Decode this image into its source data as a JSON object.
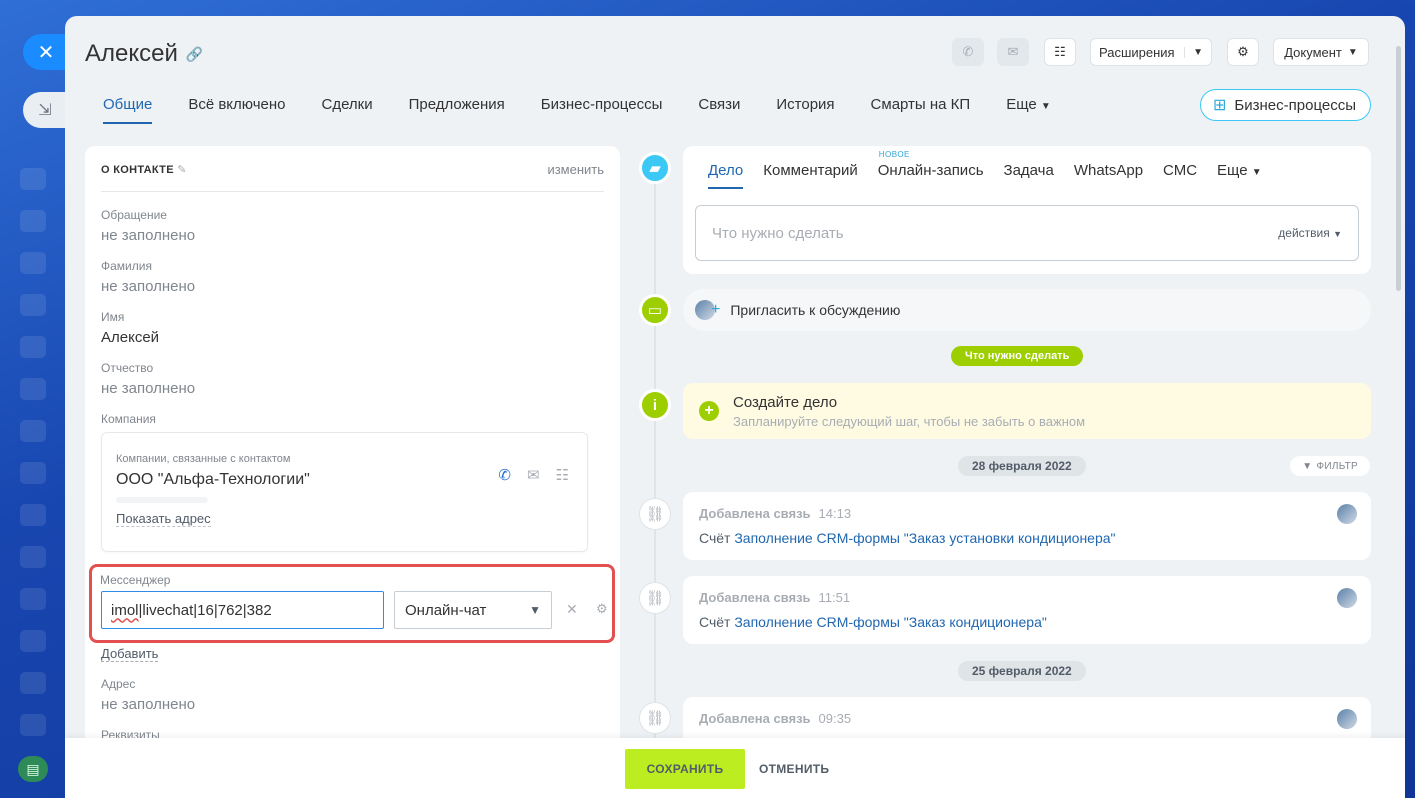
{
  "window": {
    "title": "Алексей"
  },
  "toolbar": {
    "extensions_label": "Расширения",
    "document_label": "Документ"
  },
  "tabs": [
    {
      "label": "Общие"
    },
    {
      "label": "Всё включено"
    },
    {
      "label": "Сделки"
    },
    {
      "label": "Предложения"
    },
    {
      "label": "Бизнес-процессы"
    },
    {
      "label": "Связи"
    },
    {
      "label": "История"
    },
    {
      "label": "Смарты на КП"
    },
    {
      "label": "Еще"
    }
  ],
  "bp_button_label": "Бизнес-процессы",
  "contact_card": {
    "header": "О КОНТАКТЕ",
    "edit_label": "изменить",
    "fields": [
      {
        "label": "Обращение",
        "value": "не заполнено"
      },
      {
        "label": "Фамилия",
        "value": "не заполнено"
      },
      {
        "label": "Имя",
        "value": "Алексей"
      },
      {
        "label": "Отчество",
        "value": "не заполнено"
      },
      {
        "label": "Компания",
        "value": ""
      }
    ],
    "company": {
      "subtitle": "Компании, связанные с контактом",
      "name": "ООО \"Альфа-Технологии\"",
      "address_link": "Показать адрес"
    },
    "messenger": {
      "label": "Мессенджер",
      "value_prefix": "imol",
      "value_rest": "|livechat|16|762|382",
      "type": "Онлайн-чат"
    },
    "add_label": "Добавить",
    "address": {
      "label": "Адрес",
      "value": "не заполнено"
    },
    "requisites_label": "Реквизиты"
  },
  "editor": {
    "tabs": [
      {
        "label": "Дело"
      },
      {
        "label": "Комментарий"
      },
      {
        "label": "Онлайн-запись",
        "badge": "НОВОЕ"
      },
      {
        "label": "Задача"
      },
      {
        "label": "WhatsApp"
      },
      {
        "label": "СМС"
      },
      {
        "label": "Еще"
      }
    ],
    "placeholder": "Что нужно сделать",
    "actions_label": "действия"
  },
  "invite_label": "Пригласить к обсуждению",
  "todo_pill": "Что нужно сделать",
  "create_block": {
    "title": "Создайте дело",
    "subtitle": "Запланируйте следующий шаг, чтобы не забыть о важном"
  },
  "date_1": "28 февраля 2022",
  "date_2": "25 февраля 2022",
  "filter_label": "ФИЛЬТР",
  "events": [
    {
      "title": "Добавлена связь",
      "time": "14:13",
      "prefix": "Счёт",
      "link": "Заполнение CRM-формы \"Заказ установки кондиционера\""
    },
    {
      "title": "Добавлена связь",
      "time": "11:51",
      "prefix": "Счёт",
      "link": "Заполнение CRM-формы \"Заказ кондиционера\""
    },
    {
      "title": "Добавлена связь",
      "time": "09:35"
    }
  ],
  "footer": {
    "save_label": "СОХРАНИТЬ",
    "cancel_label": "ОТМЕНИТЬ"
  },
  "colors": {
    "accent": "#2067b0",
    "save_button": "#bbed21",
    "highlight": "#e35050",
    "timeline_green": "#9dcf00",
    "timeline_blue": "#3bc8f5"
  }
}
